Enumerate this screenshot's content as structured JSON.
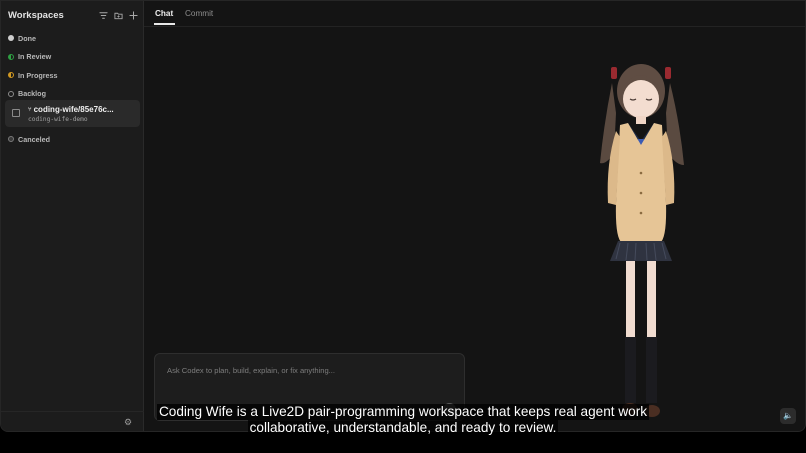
{
  "sidebar": {
    "title": "Workspaces",
    "actions": [
      {
        "name": "filter-icon"
      },
      {
        "name": "new-folder-icon"
      },
      {
        "name": "add-icon"
      }
    ],
    "groups": [
      {
        "label": "Done",
        "status": "done"
      },
      {
        "label": "In Review",
        "status": "review"
      },
      {
        "label": "In Progress",
        "status": "progress"
      },
      {
        "label": "Backlog",
        "status": "backlog"
      },
      {
        "label": "Canceled",
        "status": "canceled"
      }
    ],
    "workspace": {
      "branch": "coding-wife/85e76c...",
      "name": "coding-wife-demo"
    },
    "settings_icon": "gear-icon"
  },
  "main": {
    "tabs": [
      {
        "label": "Chat",
        "active": true
      },
      {
        "label": "Commit",
        "active": false
      }
    ],
    "composer": {
      "placeholder": "Ask Codex to plan, build, explain, or fix anything..."
    }
  },
  "caption": {
    "line1": "Coding Wife is a Live2D pair-programming workspace that keeps real agent work",
    "line2": "collaborative, understandable, and ready to review."
  },
  "colors": {
    "review": "#2ea043",
    "progress": "#d29922",
    "background": "#141414"
  }
}
